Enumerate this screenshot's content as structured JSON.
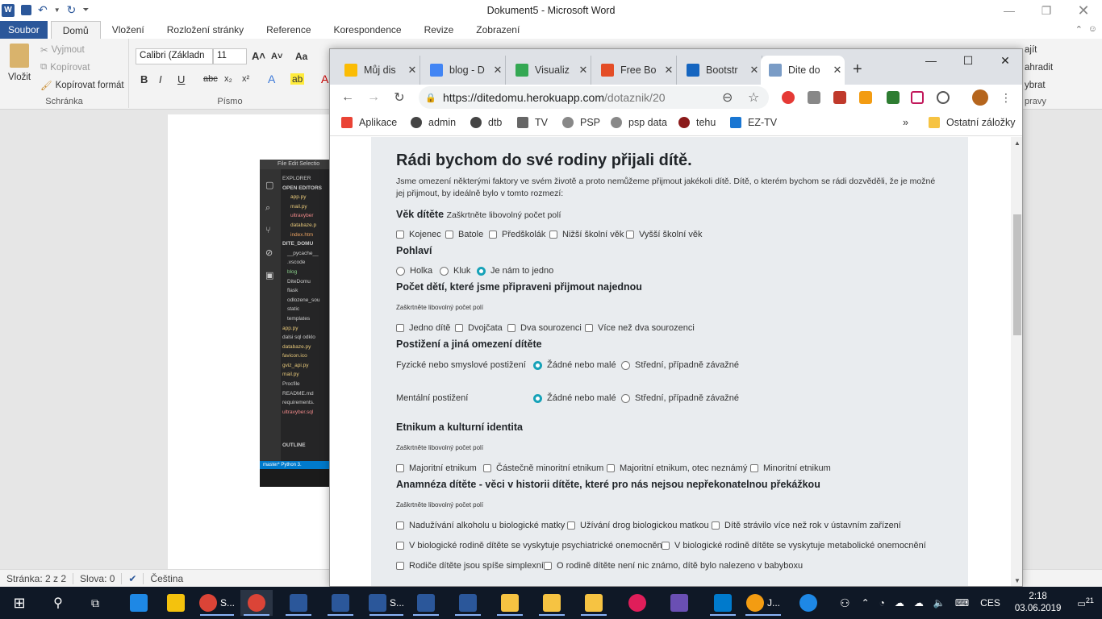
{
  "word": {
    "title": "Dokument5  -  Microsoft Word",
    "tabs": [
      "Soubor",
      "Domů",
      "Vložení",
      "Rozložení stránky",
      "Reference",
      "Korespondence",
      "Revize",
      "Zobrazení"
    ],
    "clipboard": {
      "paste": "Vložit",
      "cut": "Vyjmout",
      "copy": "Kopírovat",
      "format_painter": "Kopírovat formát",
      "group": "Schránka"
    },
    "font": {
      "name": "Calibri (Základn",
      "size": "11",
      "group": "Písmo"
    },
    "ribbon_right": {
      "find": "ajít",
      "replace": "ahradit",
      "select": "ybrat",
      "edit_group": "pravy"
    },
    "status": {
      "page": "Stránka: 2 z 2",
      "words": "Slova: 0",
      "lang": "Čeština"
    },
    "embedded": {
      "menu": "File  Edit  Selectio",
      "explorer": "EXPLORER",
      "open_editors": "OPEN EDITORS",
      "open_files": [
        "app.py",
        "mail.py",
        "ultravyber",
        "databaze.p",
        "index.htm"
      ],
      "project": "DITE_DOMU",
      "files": [
        "__pycache__",
        ".vscode",
        "blog",
        "DiteDomu",
        "flask",
        "odlozene_sou",
        "static",
        "templates",
        "app.py",
        "dalsi sql odklo",
        "databaze.py",
        "favicon.ico",
        "gviz_api.py",
        "mail.py",
        "Procfile",
        "README.md",
        "requirements.",
        "ultravyber.sql"
      ],
      "outline": "OUTLINE",
      "status": "master*   Python 3."
    }
  },
  "chrome": {
    "tabs": [
      {
        "label": "Můj dis",
        "icon_color": "#fbbc04"
      },
      {
        "label": "blog - D",
        "icon_color": "#4285f4"
      },
      {
        "label": "Visualiz",
        "icon_color": "#34a853"
      },
      {
        "label": "Free Bo",
        "icon_color": "#e44d26"
      },
      {
        "label": "Bootstr",
        "icon_color": "#1565c0"
      },
      {
        "label": "Dite do",
        "icon_color": "#7a9cc6"
      }
    ],
    "url_host": "https://ditedomu.herokuapp.com",
    "url_path": "/dotaznik/20",
    "bookmarks": [
      "Aplikace",
      "admin",
      "dtb",
      "TV",
      "PSP",
      "psp data",
      "tehu",
      "EZ-TV"
    ],
    "other_bookmarks": "Ostatní záložky"
  },
  "form": {
    "title": "Rádi bychom do své rodiny přijali dítě.",
    "intro_1": "Jsme omezení některými faktory ve svém životě a proto nemůžeme přijmout jakékoli dítě. Dítě, o kterém bychom se rádi dozvěděli, že je možné",
    "intro_2": "jej přijmout, by ideálně bylo v tomto rozmezí:",
    "any_hint": "Zaškrtněte libovolný počet polí",
    "age": {
      "title": "Věk dítěte",
      "options": [
        "Kojenec",
        "Batole",
        "Předškolák",
        "Nižší školní věk",
        "Vyšší školní věk"
      ]
    },
    "gender": {
      "title": "Pohlaví",
      "options": [
        "Holka",
        "Kluk",
        "Je nám to jedno"
      ],
      "selected": "Je nám to jedno"
    },
    "count": {
      "title": "Počet dětí, které jsme připraveni přijmout najednou",
      "options": [
        "Jedno dítě",
        "Dvojčata",
        "Dva sourozenci",
        "Více než dva sourozenci"
      ]
    },
    "disability": {
      "title": "Postižení a jiná omezení dítěte",
      "physical_label": "Fyzické nebo smyslové postižení",
      "mental_label": "Mentální postižení",
      "options": [
        "Žádné nebo malé",
        "Střední, případně závažné"
      ]
    },
    "ethnicity": {
      "title": "Etnikum a kulturní identita",
      "options": [
        "Majoritní etnikum",
        "Částečně minoritní etnikum",
        "Majoritní etnikum, otec neznámý",
        "Minoritní etnikum"
      ]
    },
    "history": {
      "title": "Anamnéza dítěte - věci v historii dítěte, které pro nás nejsou nepřekonatelnou překážkou",
      "options": [
        "Nadužívání alkoholu u biologické matky",
        "Užívání drog biologickou matkou",
        "Dítě strávilo více než rok v ústavním zařízení",
        "V biologické rodině dítěte se vyskytuje psychiatrické onemocnění",
        "V biologické rodině dítěte se vyskytuje metabolické onemocnění",
        "Rodiče dítěte jsou spíše simplexní.",
        "O rodině dítěte není nic známo, dítě bylo nalezeno v babyboxu"
      ]
    }
  },
  "taskbar": {
    "chrome_label": "S...",
    "word_label": "S...",
    "j_label": "J...",
    "lang": "CES",
    "time": "2:18",
    "date": "03.06.2019",
    "notif": "21"
  },
  "colors": {
    "word_blue": "#2b579a",
    "accent": "#17a2b8",
    "taskbar": "#0f1826"
  }
}
